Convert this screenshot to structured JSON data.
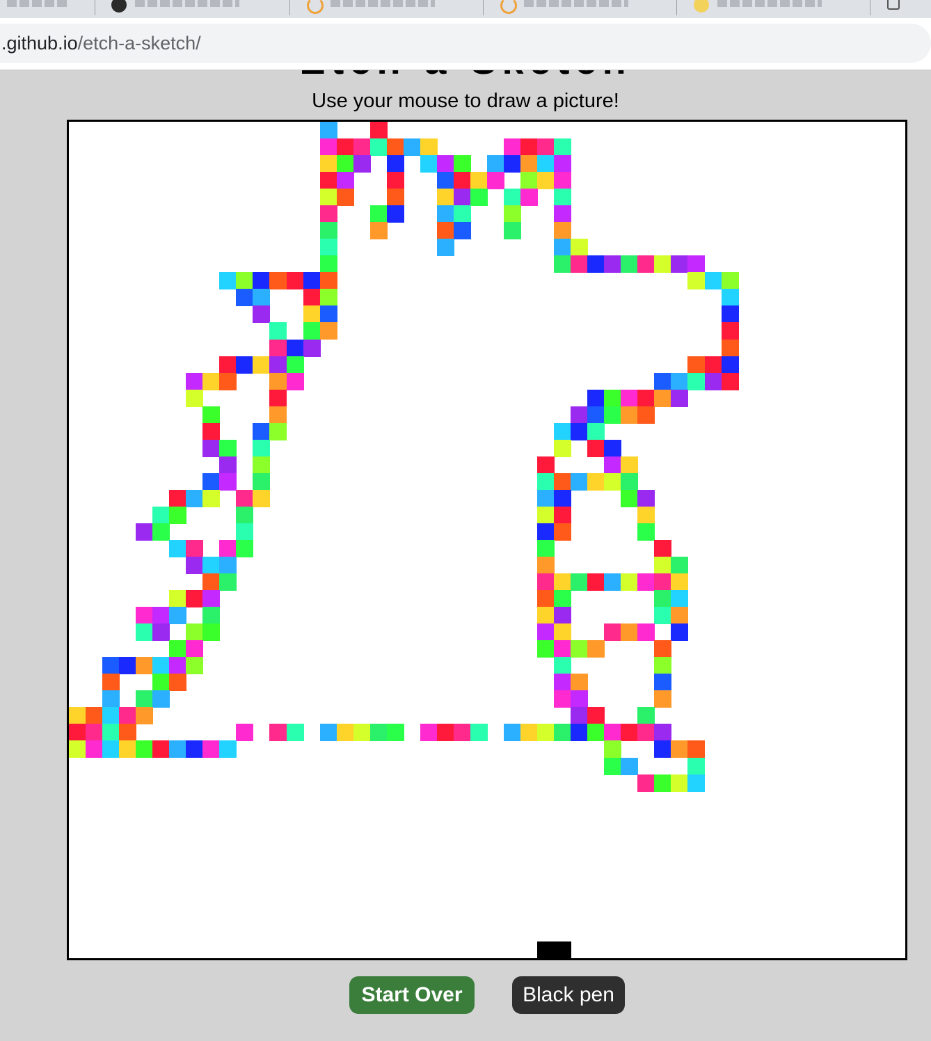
{
  "browser": {
    "url_host": ".github.io",
    "url_path": "/etch-a-sketch/"
  },
  "page": {
    "title": "Etch-a-Sketch",
    "subtitle": "Use your mouse to draw a picture!"
  },
  "grid": {
    "columns": 50,
    "rows": 50,
    "background": "#ffffff",
    "filled_cells": [
      [
        0,
        15
      ],
      [
        0,
        18
      ],
      [
        1,
        15
      ],
      [
        1,
        16
      ],
      [
        1,
        17
      ],
      [
        1,
        18
      ],
      [
        1,
        19
      ],
      [
        1,
        20
      ],
      [
        1,
        21
      ],
      [
        1,
        26
      ],
      [
        1,
        27
      ],
      [
        1,
        28
      ],
      [
        1,
        29
      ],
      [
        2,
        15
      ],
      [
        2,
        16
      ],
      [
        2,
        17
      ],
      [
        2,
        19
      ],
      [
        2,
        21
      ],
      [
        2,
        22
      ],
      [
        2,
        23
      ],
      [
        2,
        25
      ],
      [
        2,
        26
      ],
      [
        2,
        27
      ],
      [
        2,
        28
      ],
      [
        2,
        29
      ],
      [
        3,
        15
      ],
      [
        3,
        16
      ],
      [
        3,
        19
      ],
      [
        3,
        22
      ],
      [
        3,
        23
      ],
      [
        3,
        24
      ],
      [
        3,
        25
      ],
      [
        3,
        27
      ],
      [
        3,
        28
      ],
      [
        3,
        29
      ],
      [
        4,
        15
      ],
      [
        4,
        16
      ],
      [
        4,
        19
      ],
      [
        4,
        22
      ],
      [
        4,
        23
      ],
      [
        4,
        24
      ],
      [
        4,
        26
      ],
      [
        4,
        27
      ],
      [
        4,
        29
      ],
      [
        5,
        15
      ],
      [
        5,
        18
      ],
      [
        5,
        19
      ],
      [
        5,
        22
      ],
      [
        5,
        23
      ],
      [
        5,
        26
      ],
      [
        5,
        29
      ],
      [
        6,
        15
      ],
      [
        6,
        18
      ],
      [
        6,
        22
      ],
      [
        6,
        23
      ],
      [
        6,
        26
      ],
      [
        6,
        29
      ],
      [
        7,
        15
      ],
      [
        7,
        22
      ],
      [
        7,
        29
      ],
      [
        7,
        30
      ],
      [
        8,
        15
      ],
      [
        8,
        29
      ],
      [
        8,
        30
      ],
      [
        8,
        31
      ],
      [
        8,
        32
      ],
      [
        8,
        33
      ],
      [
        8,
        34
      ],
      [
        8,
        35
      ],
      [
        8,
        36
      ],
      [
        8,
        37
      ],
      [
        9,
        9
      ],
      [
        9,
        10
      ],
      [
        9,
        11
      ],
      [
        9,
        12
      ],
      [
        9,
        13
      ],
      [
        9,
        14
      ],
      [
        9,
        15
      ],
      [
        9,
        37
      ],
      [
        9,
        38
      ],
      [
        9,
        39
      ],
      [
        10,
        10
      ],
      [
        10,
        11
      ],
      [
        10,
        14
      ],
      [
        10,
        15
      ],
      [
        10,
        39
      ],
      [
        11,
        11
      ],
      [
        11,
        14
      ],
      [
        11,
        15
      ],
      [
        11,
        39
      ],
      [
        12,
        12
      ],
      [
        12,
        14
      ],
      [
        12,
        15
      ],
      [
        12,
        39
      ],
      [
        13,
        12
      ],
      [
        13,
        13
      ],
      [
        13,
        14
      ],
      [
        13,
        39
      ],
      [
        14,
        9
      ],
      [
        14,
        10
      ],
      [
        14,
        11
      ],
      [
        14,
        12
      ],
      [
        14,
        13
      ],
      [
        14,
        37
      ],
      [
        14,
        38
      ],
      [
        14,
        39
      ],
      [
        15,
        7
      ],
      [
        15,
        8
      ],
      [
        15,
        9
      ],
      [
        15,
        12
      ],
      [
        15,
        13
      ],
      [
        15,
        35
      ],
      [
        15,
        36
      ],
      [
        15,
        37
      ],
      [
        15,
        38
      ],
      [
        15,
        39
      ],
      [
        16,
        7
      ],
      [
        16,
        12
      ],
      [
        16,
        31
      ],
      [
        16,
        32
      ],
      [
        16,
        33
      ],
      [
        16,
        34
      ],
      [
        16,
        35
      ],
      [
        16,
        36
      ],
      [
        17,
        8
      ],
      [
        17,
        12
      ],
      [
        17,
        30
      ],
      [
        17,
        31
      ],
      [
        17,
        32
      ],
      [
        17,
        33
      ],
      [
        17,
        34
      ],
      [
        18,
        8
      ],
      [
        18,
        11
      ],
      [
        18,
        12
      ],
      [
        18,
        29
      ],
      [
        18,
        30
      ],
      [
        18,
        31
      ],
      [
        19,
        8
      ],
      [
        19,
        9
      ],
      [
        19,
        11
      ],
      [
        19,
        29
      ],
      [
        19,
        31
      ],
      [
        19,
        32
      ],
      [
        20,
        9
      ],
      [
        20,
        11
      ],
      [
        20,
        28
      ],
      [
        20,
        32
      ],
      [
        20,
        33
      ],
      [
        21,
        8
      ],
      [
        21,
        9
      ],
      [
        21,
        11
      ],
      [
        21,
        28
      ],
      [
        21,
        29
      ],
      [
        21,
        30
      ],
      [
        21,
        31
      ],
      [
        21,
        32
      ],
      [
        21,
        33
      ],
      [
        22,
        6
      ],
      [
        22,
        7
      ],
      [
        22,
        8
      ],
      [
        22,
        10
      ],
      [
        22,
        11
      ],
      [
        22,
        28
      ],
      [
        22,
        29
      ],
      [
        22,
        33
      ],
      [
        22,
        34
      ],
      [
        23,
        5
      ],
      [
        23,
        6
      ],
      [
        23,
        10
      ],
      [
        23,
        28
      ],
      [
        23,
        29
      ],
      [
        23,
        34
      ],
      [
        24,
        4
      ],
      [
        24,
        5
      ],
      [
        24,
        10
      ],
      [
        24,
        28
      ],
      [
        24,
        29
      ],
      [
        24,
        34
      ],
      [
        25,
        6
      ],
      [
        25,
        7
      ],
      [
        25,
        9
      ],
      [
        25,
        10
      ],
      [
        25,
        28
      ],
      [
        25,
        35
      ],
      [
        26,
        7
      ],
      [
        26,
        8
      ],
      [
        26,
        9
      ],
      [
        26,
        28
      ],
      [
        26,
        35
      ],
      [
        26,
        36
      ],
      [
        27,
        8
      ],
      [
        27,
        9
      ],
      [
        27,
        28
      ],
      [
        27,
        29
      ],
      [
        27,
        30
      ],
      [
        27,
        31
      ],
      [
        27,
        32
      ],
      [
        27,
        33
      ],
      [
        27,
        34
      ],
      [
        27,
        35
      ],
      [
        27,
        36
      ],
      [
        28,
        6
      ],
      [
        28,
        7
      ],
      [
        28,
        8
      ],
      [
        28,
        28
      ],
      [
        28,
        29
      ],
      [
        28,
        35
      ],
      [
        28,
        36
      ],
      [
        29,
        4
      ],
      [
        29,
        5
      ],
      [
        29,
        6
      ],
      [
        29,
        8
      ],
      [
        29,
        28
      ],
      [
        29,
        29
      ],
      [
        29,
        35
      ],
      [
        29,
        36
      ],
      [
        30,
        4
      ],
      [
        30,
        5
      ],
      [
        30,
        7
      ],
      [
        30,
        8
      ],
      [
        30,
        28
      ],
      [
        30,
        29
      ],
      [
        30,
        32
      ],
      [
        30,
        33
      ],
      [
        30,
        34
      ],
      [
        30,
        36
      ],
      [
        31,
        6
      ],
      [
        31,
        7
      ],
      [
        31,
        28
      ],
      [
        31,
        29
      ],
      [
        31,
        30
      ],
      [
        31,
        31
      ],
      [
        31,
        35
      ],
      [
        32,
        2
      ],
      [
        32,
        3
      ],
      [
        32,
        4
      ],
      [
        32,
        5
      ],
      [
        32,
        6
      ],
      [
        32,
        7
      ],
      [
        32,
        29
      ],
      [
        32,
        35
      ],
      [
        33,
        2
      ],
      [
        33,
        5
      ],
      [
        33,
        6
      ],
      [
        33,
        29
      ],
      [
        33,
        30
      ],
      [
        33,
        35
      ],
      [
        34,
        2
      ],
      [
        34,
        4
      ],
      [
        34,
        5
      ],
      [
        34,
        29
      ],
      [
        34,
        30
      ],
      [
        34,
        35
      ],
      [
        35,
        0
      ],
      [
        35,
        1
      ],
      [
        35,
        2
      ],
      [
        35,
        3
      ],
      [
        35,
        4
      ],
      [
        35,
        30
      ],
      [
        35,
        31
      ],
      [
        35,
        34
      ],
      [
        36,
        0
      ],
      [
        36,
        1
      ],
      [
        36,
        2
      ],
      [
        36,
        3
      ],
      [
        36,
        10
      ],
      [
        36,
        12
      ],
      [
        36,
        13
      ],
      [
        36,
        15
      ],
      [
        36,
        16
      ],
      [
        36,
        17
      ],
      [
        36,
        18
      ],
      [
        36,
        19
      ],
      [
        36,
        21
      ],
      [
        36,
        22
      ],
      [
        36,
        23
      ],
      [
        36,
        24
      ],
      [
        36,
        26
      ],
      [
        36,
        27
      ],
      [
        36,
        28
      ],
      [
        36,
        29
      ],
      [
        36,
        30
      ],
      [
        36,
        31
      ],
      [
        36,
        32
      ],
      [
        36,
        33
      ],
      [
        36,
        34
      ],
      [
        36,
        35
      ],
      [
        37,
        0
      ],
      [
        37,
        1
      ],
      [
        37,
        2
      ],
      [
        37,
        3
      ],
      [
        37,
        4
      ],
      [
        37,
        5
      ],
      [
        37,
        6
      ],
      [
        37,
        7
      ],
      [
        37,
        8
      ],
      [
        37,
        9
      ],
      [
        37,
        32
      ],
      [
        37,
        35
      ],
      [
        37,
        36
      ],
      [
        37,
        37
      ],
      [
        38,
        32
      ],
      [
        38,
        33
      ],
      [
        38,
        37
      ],
      [
        39,
        34
      ],
      [
        39,
        35
      ],
      [
        39,
        36
      ],
      [
        39,
        37
      ],
      [
        49,
        28
      ],
      [
        49,
        29
      ]
    ],
    "black_cells": [
      [
        49,
        28
      ],
      [
        49,
        29
      ]
    ]
  },
  "colors": {
    "palette": [
      "#ff1a3c",
      "#22d3ff",
      "#1a5cff",
      "#2af06a",
      "#ff2ad0",
      "#9a2af0",
      "#ff5a1a",
      "#d4ff2a",
      "#3aff2a",
      "#ff9a2a",
      "#2affb0",
      "#ffd42a",
      "#1a2aff",
      "#8cff2a",
      "#ff2a8c",
      "#2ab0ff",
      "#c42aff",
      "#2aff4a"
    ],
    "pen_black": "#000000",
    "start_over_bg": "#3b7d3b",
    "black_pen_bg": "#2f2f2f"
  },
  "controls": {
    "start_over": "Start Over",
    "black_pen": "Black pen"
  }
}
